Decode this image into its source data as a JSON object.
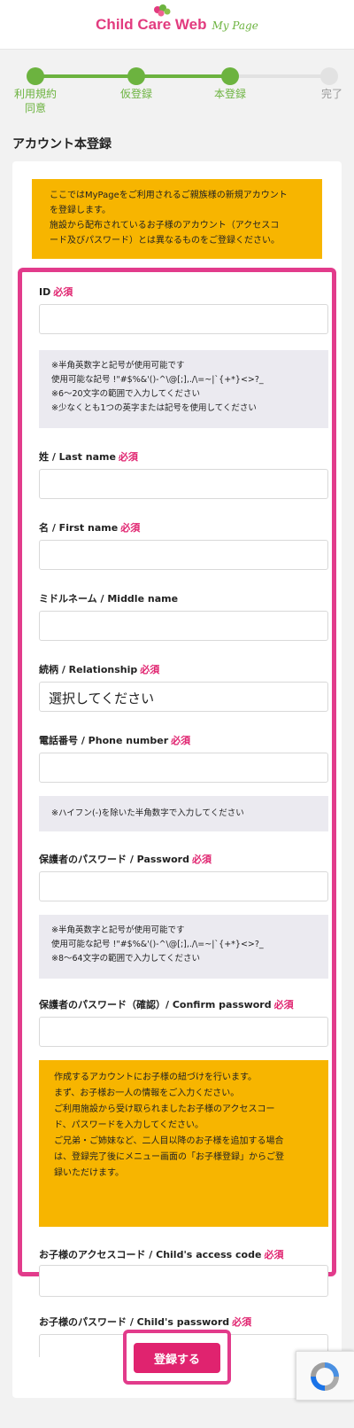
{
  "header": {
    "logo_main": "Child Care Web",
    "logo_sub": "My Page"
  },
  "stepper": {
    "steps": [
      {
        "label_line1": "利用規約",
        "label_line2": "同意"
      },
      {
        "label_line1": "仮登録"
      },
      {
        "label_line1": "本登録"
      },
      {
        "label_line1": "完了"
      }
    ]
  },
  "page": {
    "title": "アカウント本登録"
  },
  "notice_top": {
    "line1": "ここではMyPageをご利用されるご親族様の新規アカウント",
    "line2": "を登録します。",
    "line3": "施設から配布されているお子様のアカウント（アクセスコ",
    "line4": "ード及びパスワード）とは異なるものをご登録ください。"
  },
  "required_mark": "必須",
  "fields": {
    "id": {
      "label": "ID"
    },
    "id_hint": {
      "line1": "※半角英数字と記号が使用可能です",
      "line2": "使用可能な記号 !\"#$%&'()-^\\@[;],./\\=~|`{+*}<>?_",
      "line3": "※6〜20文字の範囲で入力してください",
      "line4": "※少なくとも1つの英字または記号を使用してください"
    },
    "last_name": {
      "label": "姓 / Last name"
    },
    "first_name": {
      "label": "名 / First name"
    },
    "middle_name": {
      "label": "ミドルネーム / Middle name"
    },
    "relationship": {
      "label": "続柄 / Relationship",
      "value": "選択してください"
    },
    "phone": {
      "label": "電話番号 / Phone number"
    },
    "phone_hint": "※ハイフン(-)を除いた半角数字で入力してください",
    "password": {
      "label": "保護者のパスワード / Password"
    },
    "password_hint": {
      "line1": "※半角英数字と記号が使用可能です",
      "line2": "使用可能な記号 !\"#$%&'()-^\\@[;],./\\=~|`{+*}<>?_",
      "line3": "※8〜64文字の範囲で入力してください"
    },
    "confirm_password": {
      "label": "保護者のパスワード（確認）/ Confirm password"
    },
    "child_notice": {
      "line1": "作成するアカウントにお子様の紐づけを行います。",
      "line2": "まず、お子様お一人の情報をご入力ください。",
      "line3": "ご利用施設から受け取られましたお子様のアクセスコー",
      "line4": "ド、パスワードを入力してください。",
      "line5": "ご兄弟・ご姉妹など、二人目以降のお子様を追加する場合",
      "line6": "は、登録完了後にメニュー画面の「お子様登録」からご登",
      "line7": "録いただけます。"
    },
    "child_access_code": {
      "label": "お子様のアクセスコード / Child's access code"
    },
    "child_password": {
      "label": "お子様のパスワード / Child's password"
    }
  },
  "submit": {
    "label": "登録する"
  },
  "colors": {
    "brand_pink": "#e0236f",
    "brand_green": "#6cb33f",
    "notice_yellow": "#f7b500"
  }
}
